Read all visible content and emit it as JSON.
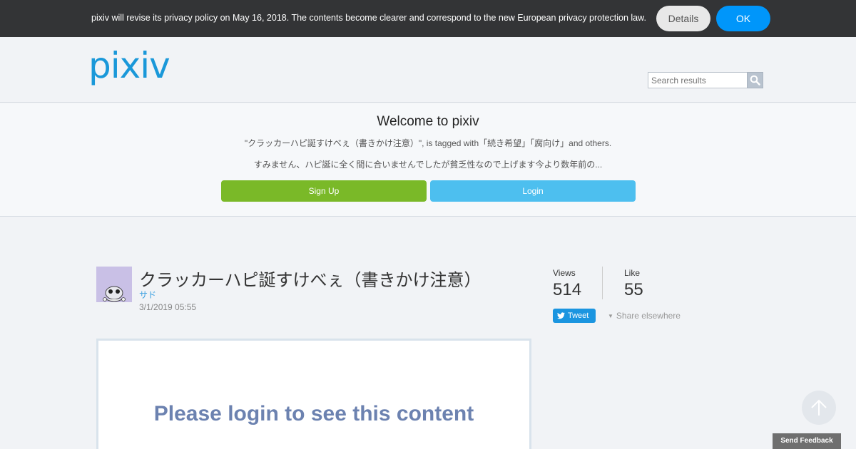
{
  "privacy_bar": {
    "text": "pixiv will revise its privacy policy on May 16, 2018. The contents become clearer and correspond to the new European privacy protection law.",
    "details_label": "Details",
    "ok_label": "OK"
  },
  "header": {
    "logo_text": "pixiv",
    "search_placeholder": "Search results"
  },
  "welcome": {
    "title": "Welcome to pixiv",
    "tags_line": "\"クラッカーハピ誕すけべぇ（書きかけ注意）\", is tagged with「続き希望」「腐向け」and others.",
    "description": "すみません、ハピ誕に全く間に合いませんでしたが貧乏性なので上げます今より数年前の...",
    "signup_label": "Sign Up",
    "login_label": "Login"
  },
  "work": {
    "title": "クラッカーハピ誕すけべぇ（書きかけ注意）",
    "author": "サド",
    "date": "3/1/2019 05:55"
  },
  "stats": {
    "views_label": "Views",
    "views_value": "514",
    "like_label": "Like",
    "like_value": "55",
    "tweet_label": "Tweet",
    "share_label": "Share elsewhere"
  },
  "content": {
    "login_message": "Please login to see this content"
  },
  "feedback": {
    "label": "Send Feedback"
  },
  "colors": {
    "privacy_bar_bg": "#333436",
    "ok_button": "#0096fa",
    "signup_button": "#7ab928",
    "login_button": "#4dbfef",
    "logo": "#1a98d9",
    "login_message": "#6c82b0"
  },
  "icons": {
    "search": "search-icon",
    "twitter": "twitter-bird-icon",
    "scroll_top": "arrow-up-icon"
  }
}
